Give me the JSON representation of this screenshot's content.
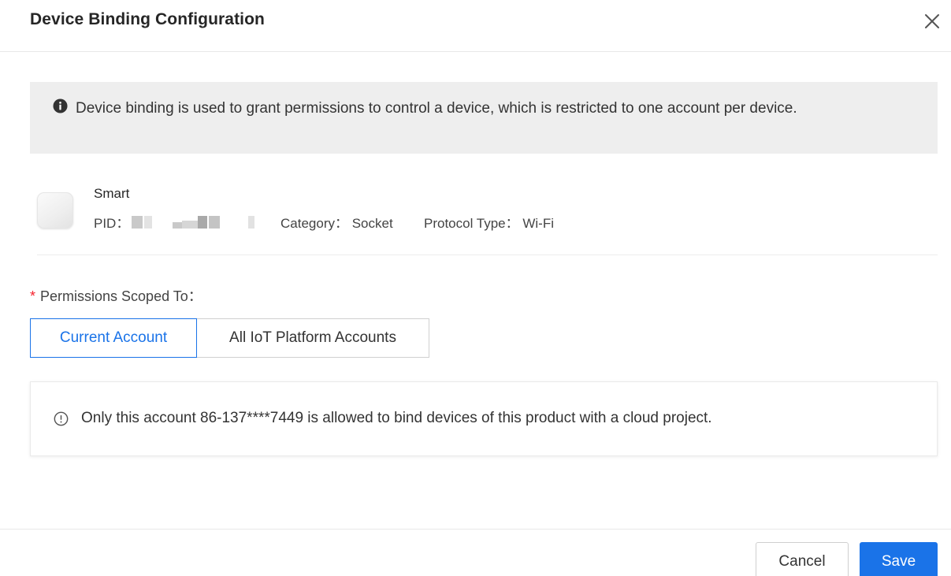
{
  "dialog": {
    "title": "Device Binding Configuration",
    "close_icon": "close-icon"
  },
  "notice": {
    "icon": "info-filled-icon",
    "text": "Device binding is used to grant permissions to control a device, which is restricted to one account per device."
  },
  "product": {
    "name": "Smart",
    "pid_label": "PID：",
    "category": "Category： Socket",
    "protocol": "Protocol Type： Wi-Fi"
  },
  "scope": {
    "required_mark": "*",
    "label": "Permissions Scoped To：",
    "options": [
      {
        "label": "Current Account",
        "selected": true
      },
      {
        "label": "All IoT Platform Accounts",
        "selected": false
      }
    ],
    "info_icon": "info-outline-icon",
    "info_text": "Only this account 86-137****7449 is allowed to bind devices of this product with a cloud project."
  },
  "footer": {
    "cancel_label": "Cancel",
    "save_label": "Save"
  },
  "colors": {
    "primary": "#1a73e8",
    "required": "#f5222d",
    "notice_bg": "#eeeeee"
  }
}
